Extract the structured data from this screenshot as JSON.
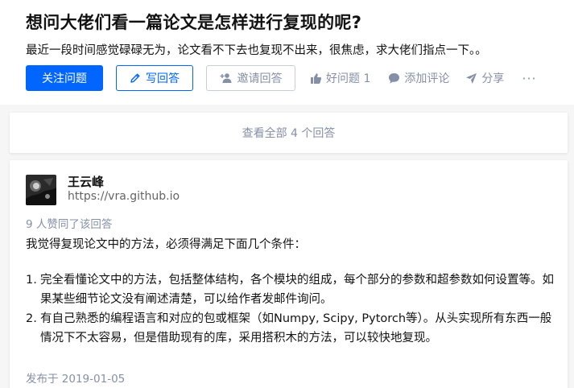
{
  "question": {
    "title": "想问大佬们看一篇论文是怎样进行复现的呢?",
    "detail": "最近一段时间感觉碌碌无为，论文看不下去也复现不出来，很焦虑，求大佬们指点一下。。"
  },
  "actions": {
    "follow": "关注问题",
    "write_answer": "写回答",
    "invite": "邀请回答",
    "good_question": "好问题 1",
    "comment": "添加评论",
    "share": "分享",
    "more": "···"
  },
  "view_all": "查看全部 4 个回答",
  "answer": {
    "author": "王云峰",
    "author_url": "https://vra.github.io",
    "votes": "9 人赞同了该回答",
    "intro": "我觉得复现论文中的方法，必须得满足下面几个条件：",
    "items": [
      {
        "num": "1.",
        "text": "完全看懂论文中的方法，包括整体结构，各个模块的组成，每个部分的参数和超参数如何设置等。如果某些细节论文没有阐述清楚，可以给作者发邮件询问。"
      },
      {
        "num": "2.",
        "text": "有自己熟悉的编程语言和对应的包或框架（如Numpy, Scipy, Pytorch等）。从头实现所有东西一般情况下不太容易，但是借助现有的库，采用搭积木的方法，可以较快地复现。"
      }
    ],
    "posted": "发布于 2019-01-05"
  },
  "colors": {
    "brand_blue": "#0066ff",
    "muted": "#8590a6",
    "text": "#121212",
    "page_bg": "#f6f6f6"
  },
  "icons": [
    "pen-icon",
    "invite-icon",
    "thumb-up-icon",
    "comment-icon",
    "share-icon",
    "avatar-image"
  ]
}
